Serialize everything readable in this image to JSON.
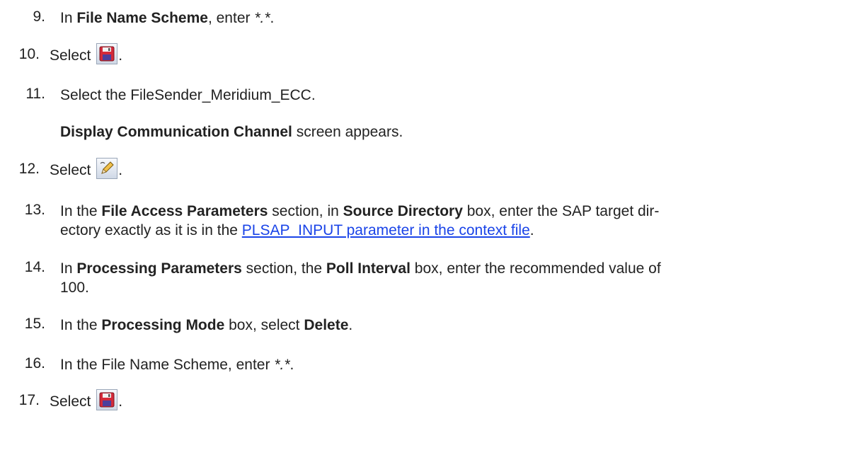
{
  "steps": [
    {
      "number": "9.",
      "parts": {
        "a": "In ",
        "b": "File Name Scheme",
        "c": ", enter ",
        "d": "*.*",
        "e": "."
      }
    },
    {
      "number": "10.",
      "parts": {
        "a": "Select ",
        "e": "."
      },
      "icon": "save-icon"
    },
    {
      "number": "11.",
      "parts": {
        "a": "Select the FileSender_Meridium_ECC."
      },
      "sub": {
        "b": "Display Communication Channel",
        "c": " screen appears."
      }
    },
    {
      "number": "12.",
      "parts": {
        "a": "Select ",
        "e": "."
      },
      "icon": "edit-pencil-icon"
    },
    {
      "number": "13.",
      "parts": {
        "a": "In the ",
        "b": "File Access Parameters",
        "c": " section, in ",
        "d": "Source Directory",
        "e": " box, enter the SAP target dir-",
        "f": "ectory exactly as it is in the ",
        "link": "PLSAP_INPUT parameter in the context file",
        "g": "."
      }
    },
    {
      "number": "14.",
      "parts": {
        "a": "In ",
        "b": "Processing Parameters",
        "c": " section, the ",
        "d": "Poll Interval",
        "e": " box, enter the recommended value of",
        "f": "100."
      }
    },
    {
      "number": "15.",
      "parts": {
        "a": "In the ",
        "b": "Processing Mode",
        "c": " box, select ",
        "d": "Delete",
        "e": "."
      }
    },
    {
      "number": "16.",
      "parts": {
        "a": "In the File Name Scheme, enter ",
        "d": "*.*",
        "e": "."
      }
    },
    {
      "number": "17.",
      "parts": {
        "a": "Select ",
        "e": "."
      },
      "icon": "save-icon"
    }
  ],
  "colors": {
    "text": "#222222",
    "link": "#1a44e8",
    "save_icon": "#d42a3a"
  }
}
